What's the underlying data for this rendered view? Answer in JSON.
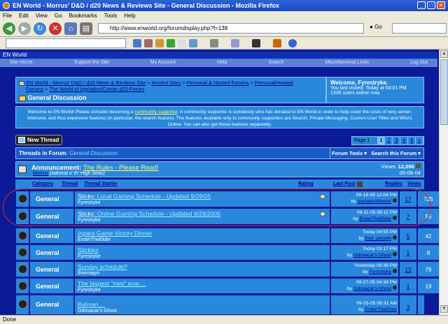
{
  "window": {
    "title": "EN World - Morrus' D&D / d20 News & Reviews Site - General Discussion - Mozilla Firefox"
  },
  "menu": [
    "File",
    "Edit",
    "View",
    "Go",
    "Bookmarks",
    "Tools",
    "Help"
  ],
  "address": {
    "url": "http://www.enworld.org/forumdisplay.php?f=138",
    "go": "Go"
  },
  "site": {
    "band": "EN World",
    "nav": [
      "Site Home",
      "Support the Site",
      "My Account",
      "Help",
      "Search",
      "Miscellaneous Links",
      "Log Out"
    ]
  },
  "breadcrumb": {
    "line1": [
      "EN World - Morrus' D&D / d20 News & Reviews Site",
      "Hosted Sites",
      "Personal & Hosted Forums",
      "Personal/Hosted"
    ],
    "line2": [
      "Forums",
      "The World of Injeladun/Conan d20 Forum"
    ],
    "title": "General Discussion"
  },
  "welcome": {
    "greeting": "Welcome, Fyrestryke.",
    "visited": "You last visited: Today at 04:01 PM",
    "online": "1336 users online now."
  },
  "notice": {
    "pre": "Welcome to EN World! Please consider becoming a ",
    "link": "community supporter",
    "post": ". A community supporter is somebody who has donated to EN World in order to help cover the costs of very server-intensive, and thus expensive features (in particular, the search feature). The features available only to community supporters are Search, Private Messaging, Custom User Titles and Who's Online. You can also get these features separately."
  },
  "new_thread": "New Thread",
  "pager": {
    "label": "Page 1 of 5",
    "pages": [
      "1",
      "2",
      "3",
      "4",
      "5"
    ],
    "next": "»"
  },
  "forum_header": {
    "label": "Threads in Forum",
    "forum": "General Discussion",
    "tools": "Forum Tools",
    "search": "Search this Forum"
  },
  "announcement": {
    "label": "Announcement:",
    "title": "The Rules - Please Read!",
    "author": "Morrus",
    "author_title": "(Admiral o' th' High Seas)",
    "views_label": "Views:",
    "views": "12,096",
    "date": "05-08-04"
  },
  "columns": {
    "category": "Category",
    "thread": "Thread",
    "starter": "Thread Starter",
    "rating": "Rating",
    "last_post": "Last Post",
    "replies": "Replies",
    "views": "Views"
  },
  "threads": [
    {
      "prefix": "General",
      "sticky": "Sticky:",
      "title": "Local Gaming Schedule - Updated 9/29/05",
      "starter": "Fyrestryke",
      "date": "09-18-05 12:04 PM",
      "by": "InjeladunMaster",
      "replies": "17",
      "views": "725"
    },
    {
      "prefix": "General",
      "sticky": "Sticky:",
      "title": "Online Gaming Schedule - Updated 9/29/2005",
      "starter": "Fyrestryke",
      "date": "09-11-05 08:11 PM",
      "by": "EnderTheElder",
      "replies": "7",
      "views": "55"
    },
    {
      "prefix": "General",
      "sticky": "",
      "title": "Ingara Game Victory Dinner",
      "starter": "EnderTheElder",
      "date": "Today 04:55 PM",
      "by": "fred_jaboobi",
      "replies": "5",
      "views": "42"
    },
    {
      "prefix": "General",
      "sticky": "",
      "title": "Stickies",
      "starter": "Fyrestryke",
      "date": "Today 03:17 PM",
      "by": "Odovacar's Ghost",
      "replies": "1",
      "views": "8"
    },
    {
      "prefix": "General",
      "sticky": "",
      "title": "Sunday schedule?",
      "starter": "thormagni",
      "date": "Yesterday 08:39 PM",
      "by": "Fyrestryke",
      "replies": "13",
      "views": "79"
    },
    {
      "prefix": "General",
      "sticky": "",
      "title": "The biggest \"mini\" evar....",
      "starter": "Fyrestryke",
      "date": "09-27-05 04:34 PM",
      "by": "Odovacar's Ghost",
      "replies": "1",
      "views": "19"
    },
    {
      "prefix": "General",
      "sticky": "",
      "title": "Batman....",
      "starter": "Odovacar's Ghost",
      "date": "09-23-05 08:31 AM",
      "by": "EnderTheElder",
      "replies": "3",
      "views": "31"
    }
  ],
  "by_label": "by",
  "status": "Done"
}
